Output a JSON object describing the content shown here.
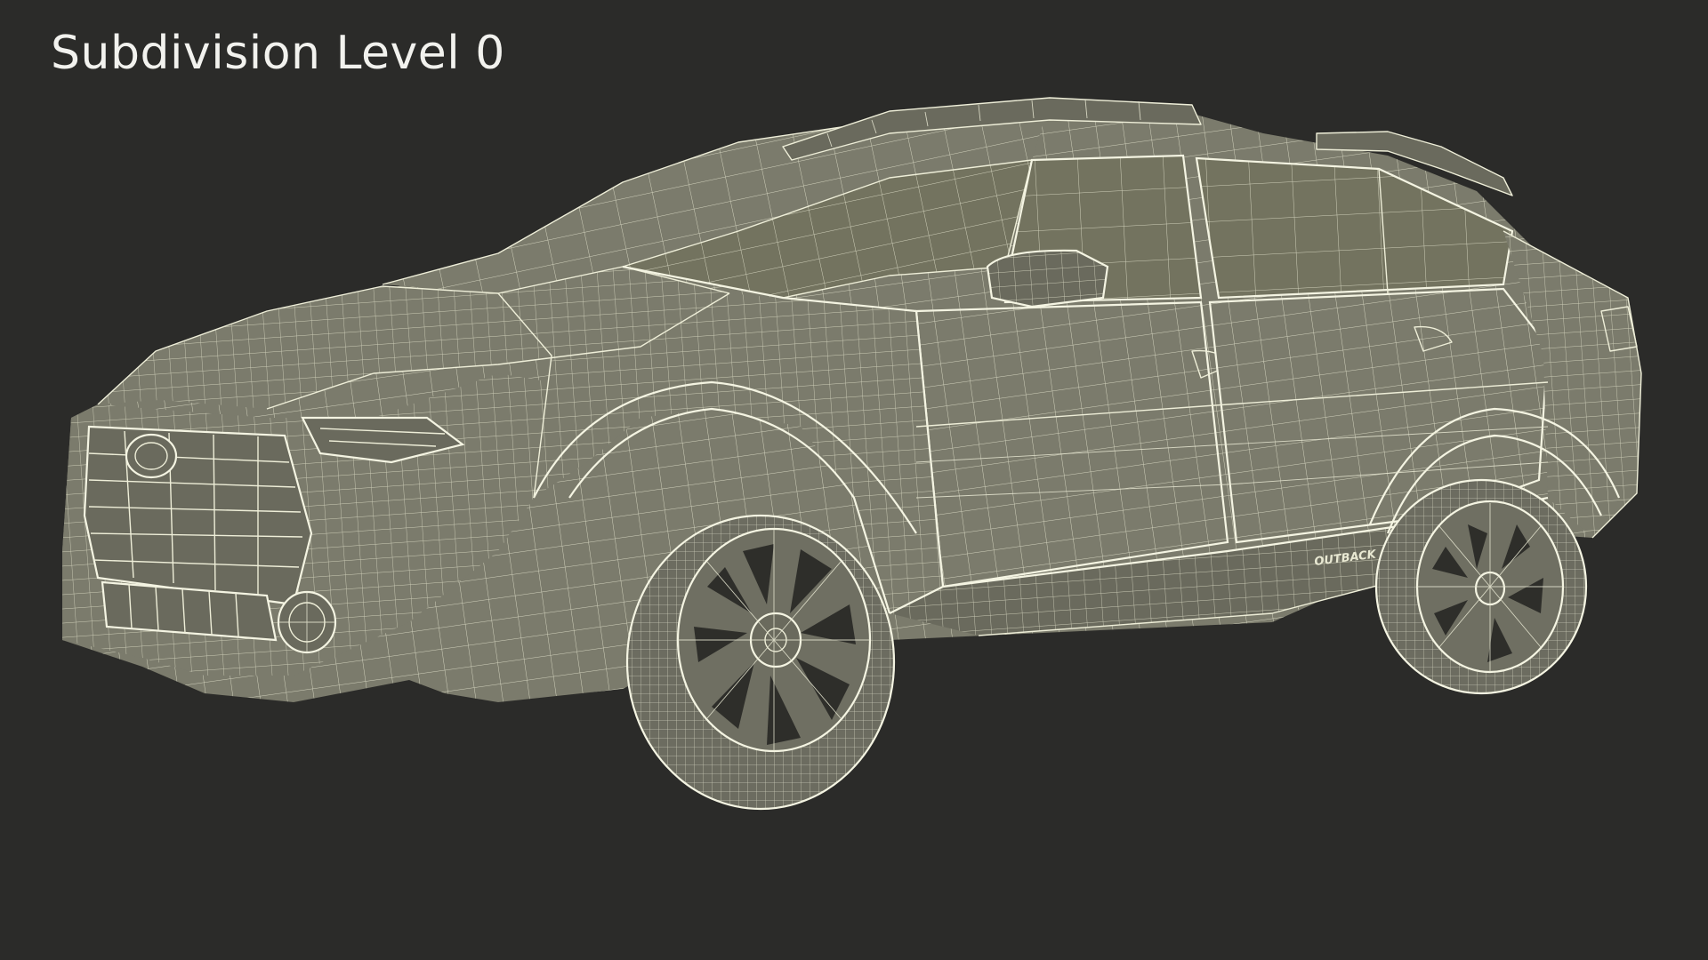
{
  "heading": {
    "title": "Subdivision Level 0"
  },
  "model": {
    "badge": "OUTBACK"
  },
  "colors": {
    "background": "#2b2b29",
    "surface": "#7b7b6c",
    "wireframe": "#eeeed8",
    "title_text": "#f2f2ee"
  }
}
